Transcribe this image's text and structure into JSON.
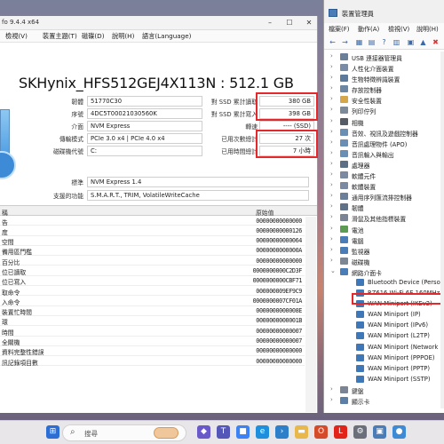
{
  "cdi": {
    "title": "fo 9.4.4 x64",
    "menu": [
      "檢視(V)",
      "裝置主題(T)",
      "磁碟(D)",
      "說明(H)",
      "語言(Language)"
    ],
    "drive_title": "SKHynix_HFS512GEJ4X113N : 512.1 GB",
    "left_fields": [
      {
        "label": "韌體",
        "value": "51770C30"
      },
      {
        "label": "序號",
        "value": "4DC5T00021030560K"
      },
      {
        "label": "介面",
        "value": "NVM Express"
      },
      {
        "label": "傳輸模式",
        "value": "PCIe 3.0 x4 | PCIe 4.0 x4"
      },
      {
        "label": "磁碟機代號",
        "value": "C:"
      },
      {
        "label": "標準",
        "value": "NVM Express 1.4"
      },
      {
        "label": "支援的功能",
        "value": "S.M.A.R.T., TRIM, VolatileWriteCache"
      }
    ],
    "right_fields": [
      {
        "label": "對 SSD 累計讀取",
        "value": "380 GB"
      },
      {
        "label": "對 SSD 累計寫入",
        "value": "398 GB"
      },
      {
        "label": "轉速",
        "value": "---- (SSD)"
      },
      {
        "label": "已用次數總計",
        "value": "27 次"
      },
      {
        "label": "已用時間總計",
        "value": "7 小時"
      }
    ],
    "table_headers": {
      "name": "稱",
      "raw": "原始值"
    },
    "smart_rows": [
      {
        "name": "告",
        "raw": "00000000000000"
      },
      {
        "name": "度",
        "raw": "00000000000126"
      },
      {
        "name": "空間",
        "raw": "00000000000064"
      },
      {
        "name": "備用區門檻",
        "raw": "0000000000000A"
      },
      {
        "name": "百分比",
        "raw": "00000000000000"
      },
      {
        "name": "位已讀取",
        "raw": "0000000000C2D3F"
      },
      {
        "name": "位已寫入",
        "raw": "0000000000CBF71"
      },
      {
        "name": "取命令",
        "raw": "000000009EF9C9"
      },
      {
        "name": "入命令",
        "raw": "0000000007CF01A"
      },
      {
        "name": "裝置忙時間",
        "raw": "0000000000008E"
      },
      {
        "name": "環",
        "raw": "0000000000001B"
      },
      {
        "name": "時間",
        "raw": "00000000000007"
      },
      {
        "name": "全關機",
        "raw": "00000000000007"
      },
      {
        "name": "資料完整性錯誤",
        "raw": "00000000000000"
      },
      {
        "name": "訊記錄項目數",
        "raw": "00000000000000"
      }
    ]
  },
  "dm": {
    "title": "裝置管理員",
    "menu": [
      "檔案(F)",
      "動作(A)",
      "檢視(V)",
      "說明(H)"
    ],
    "tree": [
      {
        "label": "USB 連接器管理員",
        "level": 1,
        "chev": "›",
        "color": "#6b7f99"
      },
      {
        "label": "人性化介面裝置",
        "level": 1,
        "chev": "›",
        "color": "#7a8ba6"
      },
      {
        "label": "生物特徵辨識裝置",
        "level": 1,
        "chev": "›",
        "color": "#5d7a9c"
      },
      {
        "label": "存放控制器",
        "level": 1,
        "chev": "›",
        "color": "#6d87a3"
      },
      {
        "label": "安全性裝置",
        "level": 1,
        "chev": "›",
        "color": "#d6a64a"
      },
      {
        "label": "列印佇列",
        "level": 1,
        "chev": "›",
        "color": "#7d8a99"
      },
      {
        "label": "相機",
        "level": 1,
        "chev": "›",
        "color": "#555c66"
      },
      {
        "label": "音效、視訊及遊戲控制器",
        "level": 1,
        "chev": "›",
        "color": "#6a8fb4"
      },
      {
        "label": "音訊處理物件 (APO)",
        "level": 1,
        "chev": "›",
        "color": "#6a8fb4"
      },
      {
        "label": "音訊輸入與輸出",
        "level": 1,
        "chev": "›",
        "color": "#6a8fb4"
      },
      {
        "label": "處理器",
        "level": 1,
        "chev": "›",
        "color": "#5c6f85"
      },
      {
        "label": "軟體元件",
        "level": 1,
        "chev": "›",
        "color": "#7b8aa0"
      },
      {
        "label": "軟體裝置",
        "level": 1,
        "chev": "›",
        "color": "#7b8aa0"
      },
      {
        "label": "通用序列匯流排控制器",
        "level": 1,
        "chev": "›",
        "color": "#6b7f99"
      },
      {
        "label": "韌體",
        "level": 1,
        "chev": "›",
        "color": "#5f7287"
      },
      {
        "label": "滑鼠及其他指標裝置",
        "level": 1,
        "chev": "›",
        "color": "#7a8494"
      },
      {
        "label": "電池",
        "level": 1,
        "chev": "›",
        "color": "#5b9b54"
      },
      {
        "label": "電腦",
        "level": 1,
        "chev": "›",
        "color": "#4a7db8"
      },
      {
        "label": "監視器",
        "level": 1,
        "chev": "›",
        "color": "#4a7db8"
      },
      {
        "label": "磁碟機",
        "level": 1,
        "chev": "›",
        "color": "#7d8694"
      },
      {
        "label": "網路介面卡",
        "level": 1,
        "chev": "⌄",
        "color": "#4a7db8"
      },
      {
        "label": "Bluetooth Device (Persona",
        "level": 2,
        "chev": "",
        "color": "#3f78b8"
      },
      {
        "label": "RZ616 Wi-Fi 6E 160MHz",
        "level": 2,
        "chev": "",
        "color": "#3f78b8"
      },
      {
        "label": "WAN Miniport (IKEv2)",
        "level": 2,
        "chev": "",
        "color": "#3f78b8"
      },
      {
        "label": "WAN Miniport (IP)",
        "level": 2,
        "chev": "",
        "color": "#3f78b8"
      },
      {
        "label": "WAN Miniport (IPv6)",
        "level": 2,
        "chev": "",
        "color": "#3f78b8"
      },
      {
        "label": "WAN Miniport (L2TP)",
        "level": 2,
        "chev": "",
        "color": "#3f78b8"
      },
      {
        "label": "WAN Miniport (Network",
        "level": 2,
        "chev": "",
        "color": "#3f78b8"
      },
      {
        "label": "WAN Miniport (PPPOE)",
        "level": 2,
        "chev": "",
        "color": "#3f78b8"
      },
      {
        "label": "WAN Miniport (PPTP)",
        "level": 2,
        "chev": "",
        "color": "#3f78b8"
      },
      {
        "label": "WAN Miniport (SSTP)",
        "level": 2,
        "chev": "",
        "color": "#3f78b8"
      },
      {
        "label": "鍵盤",
        "level": 1,
        "chev": "›",
        "color": "#7a8494"
      },
      {
        "label": "顯示卡",
        "level": 1,
        "chev": "›",
        "color": "#5b7fa6"
      }
    ]
  },
  "taskbar": {
    "search_placeholder": "搜尋",
    "apps": [
      {
        "name": "start",
        "color": "#2b6fd6",
        "glyph": "⊞"
      },
      {
        "name": "copilot",
        "color": "#6a59c9",
        "glyph": "◆"
      },
      {
        "name": "teams",
        "color": "#5457b8",
        "glyph": "T"
      },
      {
        "name": "store",
        "color": "#3b82f6",
        "glyph": "■"
      },
      {
        "name": "edge",
        "color": "#1d8fdc",
        "glyph": "e"
      },
      {
        "name": "vscode",
        "color": "#2d7fc9",
        "glyph": "›"
      },
      {
        "name": "files",
        "color": "#e8b84a",
        "glyph": "▬"
      },
      {
        "name": "office",
        "color": "#d54b2a",
        "glyph": "O"
      },
      {
        "name": "lenovo",
        "color": "#e2231a",
        "glyph": "L"
      },
      {
        "name": "settings",
        "color": "#6b6f7a",
        "glyph": "⚙"
      },
      {
        "name": "device-manager",
        "color": "#4a7db8",
        "glyph": "▣"
      },
      {
        "name": "diskinfo",
        "color": "#3d8ad6",
        "glyph": "●"
      }
    ]
  }
}
